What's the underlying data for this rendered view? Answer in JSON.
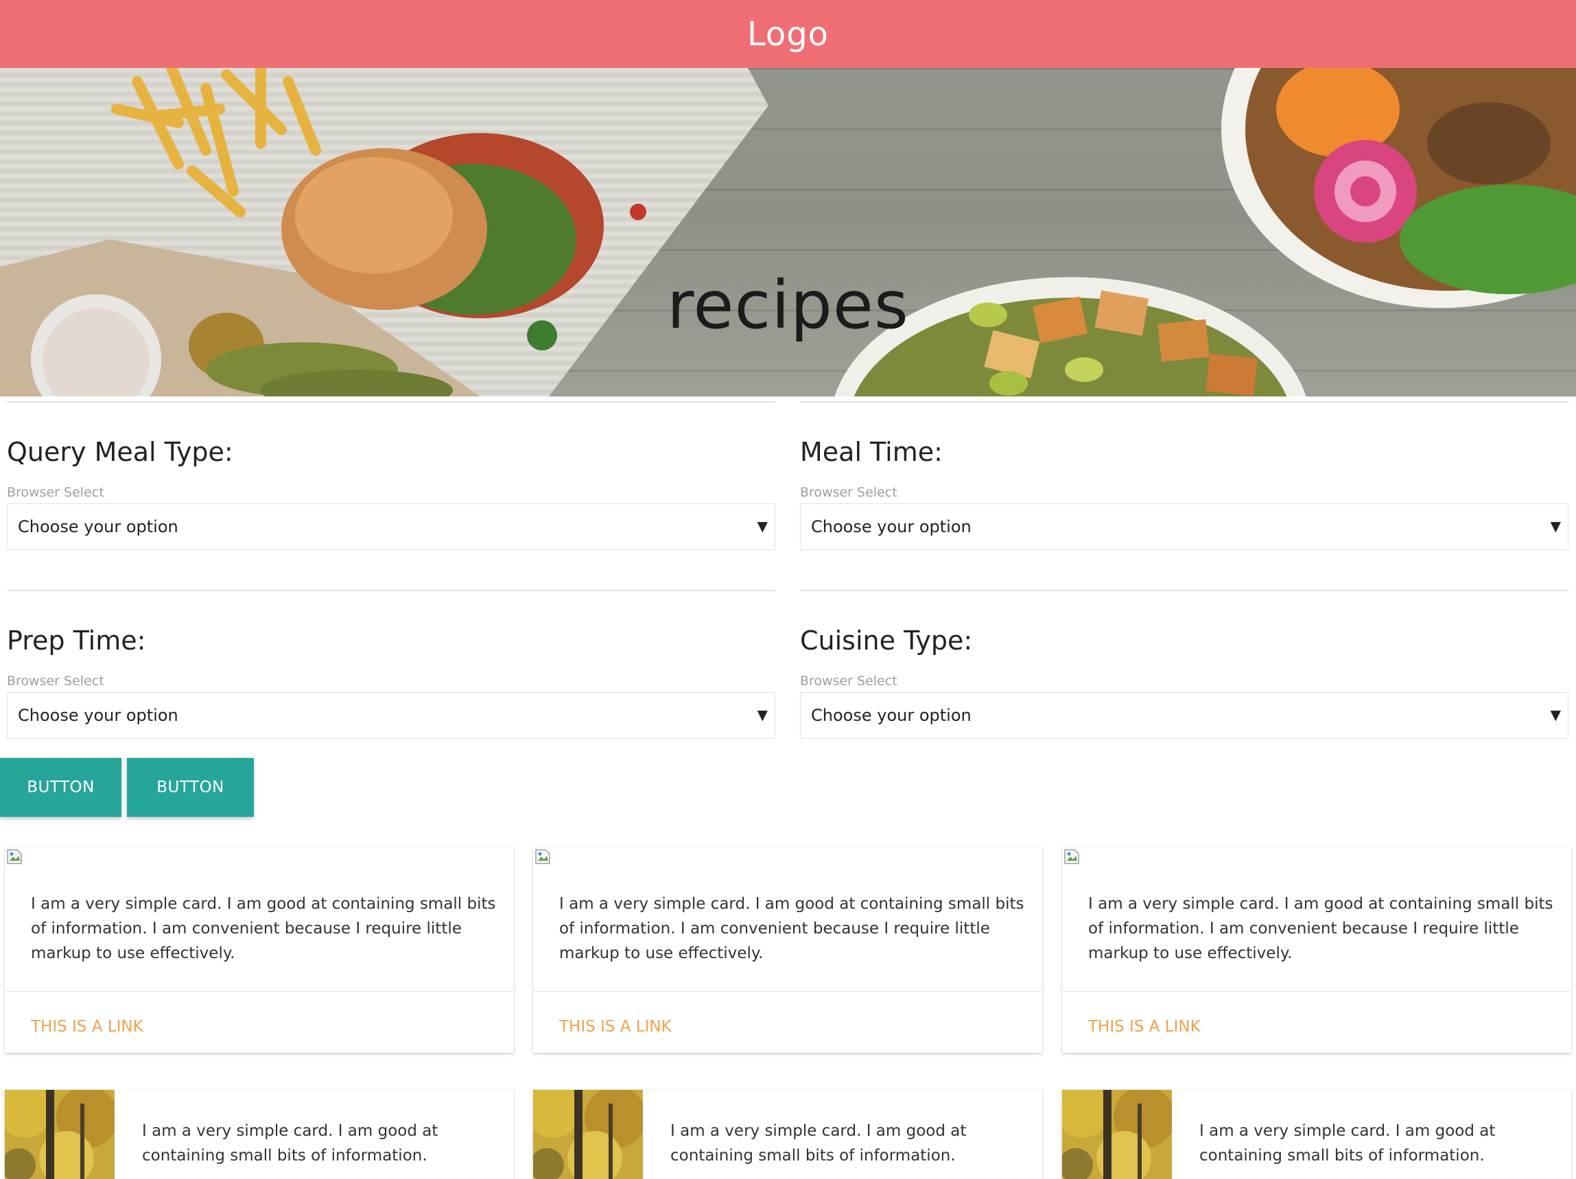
{
  "navbar": {
    "logo": "Logo"
  },
  "hero": {
    "title": "recipes"
  },
  "filters": [
    {
      "label": "Query Meal Type:",
      "helper": "Browser Select",
      "value": "Choose your option"
    },
    {
      "label": "Meal Time:",
      "helper": "Browser Select",
      "value": "Choose your option"
    },
    {
      "label": "Prep Time:",
      "helper": "Browser Select",
      "value": "Choose your option"
    },
    {
      "label": "Cuisine Type:",
      "helper": "Browser Select",
      "value": "Choose your option"
    }
  ],
  "dropdown_arrow": "▼",
  "buttons": [
    "BUTTON",
    "BUTTON"
  ],
  "cards": [
    {
      "text": "I am a very simple card. I am good at containing small bits of information. I am convenient because I require little markup to use effectively.",
      "link": "This is a link"
    },
    {
      "text": "I am a very simple card. I am good at containing small bits of information. I am convenient because I require little markup to use effectively.",
      "link": "This is a link"
    },
    {
      "text": "I am a very simple card. I am good at containing small bits of information. I am convenient because I require little markup to use effectively.",
      "link": "This is a link"
    }
  ],
  "horizontal_cards": [
    {
      "text": "I am a very simple card. I am good at containing small bits of information."
    },
    {
      "text": "I am a very simple card. I am good at containing small bits of information."
    },
    {
      "text": "I am a very simple card. I am good at containing small bits of information."
    }
  ],
  "colors": {
    "navbar": "#ef6e74",
    "button": "#26a69a",
    "link": "#f0a24d"
  }
}
